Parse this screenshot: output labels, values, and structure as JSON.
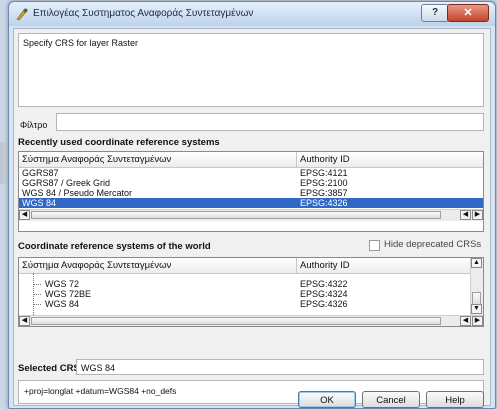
{
  "window": {
    "title": "Επιλογέας Συστηματος Αναφοράς Συντεταγμένων",
    "help_button": "?",
    "close_button": "✕"
  },
  "description": "Specify CRS for layer Raster",
  "filter": {
    "label": "Φίλτρο",
    "value": ""
  },
  "recent": {
    "title": "Recently used coordinate reference systems",
    "columns": [
      "Σύστημα Αναφοράς Συντεταγμένων",
      "Authority ID"
    ],
    "rows": [
      {
        "name": "GGRS87",
        "id": "EPSG:4121",
        "selected": false
      },
      {
        "name": "GGRS87 / Greek Grid",
        "id": "EPSG:2100",
        "selected": false
      },
      {
        "name": "WGS 84 / Pseudo Mercator",
        "id": "EPSG:3857",
        "selected": false
      },
      {
        "name": "WGS 84",
        "id": "EPSG:4326",
        "selected": true
      }
    ]
  },
  "world": {
    "title": "Coordinate reference systems of the world",
    "hide_deprecated_label": "Hide deprecated CRSs",
    "hide_deprecated_checked": false,
    "columns": [
      "Σύστημα Αναφοράς Συντεταγμένων",
      "Authority ID"
    ],
    "rows": [
      {
        "name": "WGS 72",
        "id": "EPSG:4322"
      },
      {
        "name": "WGS 72BE",
        "id": "EPSG:4324"
      },
      {
        "name": "WGS 84",
        "id": "EPSG:4326"
      }
    ]
  },
  "selected_crs": {
    "label": "Selected CRS:",
    "value": "WGS 84"
  },
  "proj_string": "+proj=longlat +datum=WGS84 +no_defs",
  "buttons": {
    "ok": "OK",
    "cancel": "Cancel",
    "help": "Help"
  },
  "colors": {
    "selection": "#3168c6",
    "window_frame": "#6a88b0",
    "close_button": "#c3452c"
  }
}
